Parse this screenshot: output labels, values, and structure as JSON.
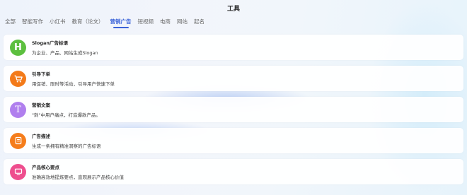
{
  "header": {
    "title": "工具"
  },
  "tabs": [
    {
      "label": "全部"
    },
    {
      "label": "智能写作"
    },
    {
      "label": "小红书"
    },
    {
      "label": "教育（论文）"
    },
    {
      "label": "营销广告"
    },
    {
      "label": "短视频"
    },
    {
      "label": "电商"
    },
    {
      "label": "网站"
    },
    {
      "label": "起名"
    }
  ],
  "cards": [
    {
      "title": "Slogan广告标语",
      "desc": "为企业、产品、网站生成Slogan",
      "icon": "letter-h-icon",
      "glyph": "H",
      "color": "#5cbf3f"
    },
    {
      "title": "引导下单",
      "desc": "用促销、限时等活动，引导用户快速下单",
      "icon": "cart-icon",
      "glyph": "",
      "color": "#f37a1a"
    },
    {
      "title": "营销文案",
      "desc": "\"刺\"中用户痛点，打造爆款产品。",
      "icon": "text-t-icon",
      "glyph": "T",
      "color": "#b07fee"
    },
    {
      "title": "广告描述",
      "desc": "生成一条拥有精准洞察的广告标语",
      "icon": "document-icon",
      "glyph": "",
      "color": "#f57d1c"
    },
    {
      "title": "产品核心要点",
      "desc": "准确高效地提炼要点，直观展示产品核心价值",
      "icon": "monitor-icon",
      "glyph": "",
      "color": "#ee4e8e"
    }
  ]
}
